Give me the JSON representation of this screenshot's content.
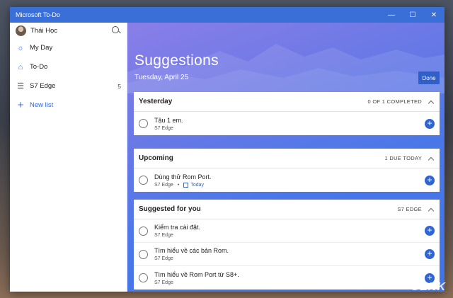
{
  "window": {
    "title": "Microsoft To-Do"
  },
  "sidebar": {
    "user_name": "Thái Học",
    "items": [
      {
        "label": "My Day",
        "icon": "sun-icon",
        "count": ""
      },
      {
        "label": "To-Do",
        "icon": "home-icon",
        "count": ""
      },
      {
        "label": "S7 Edge",
        "icon": "list-icon",
        "count": "5"
      }
    ],
    "new_list_label": "New list"
  },
  "main": {
    "heading": "Suggestions",
    "date": "Tuesday, April 25",
    "done_label": "Done",
    "sections": [
      {
        "title": "Yesterday",
        "meta": "0 OF 1 COMPLETED",
        "tasks": [
          {
            "title": "Tậu 1 em.",
            "list": "S7 Edge",
            "due": ""
          }
        ]
      },
      {
        "title": "Upcoming",
        "meta": "1 DUE TODAY",
        "tasks": [
          {
            "title": "Dùng thử Rom Port.",
            "list": "S7 Edge",
            "due": "Today"
          }
        ]
      },
      {
        "title": "Suggested for you",
        "meta": "S7 EDGE",
        "tasks": [
          {
            "title": "Kiểm tra cài đặt.",
            "list": "S7 Edge",
            "due": ""
          },
          {
            "title": "Tìm hiểu về các bản Rom.",
            "list": "S7 Edge",
            "due": ""
          },
          {
            "title": "Tìm hiểu về Rom Port từ S8+.",
            "list": "S7 Edge",
            "due": ""
          }
        ]
      }
    ]
  },
  "watermark": "GENK",
  "colors": {
    "accent": "#2f66d4",
    "titlebar": "#3a6fd8"
  }
}
